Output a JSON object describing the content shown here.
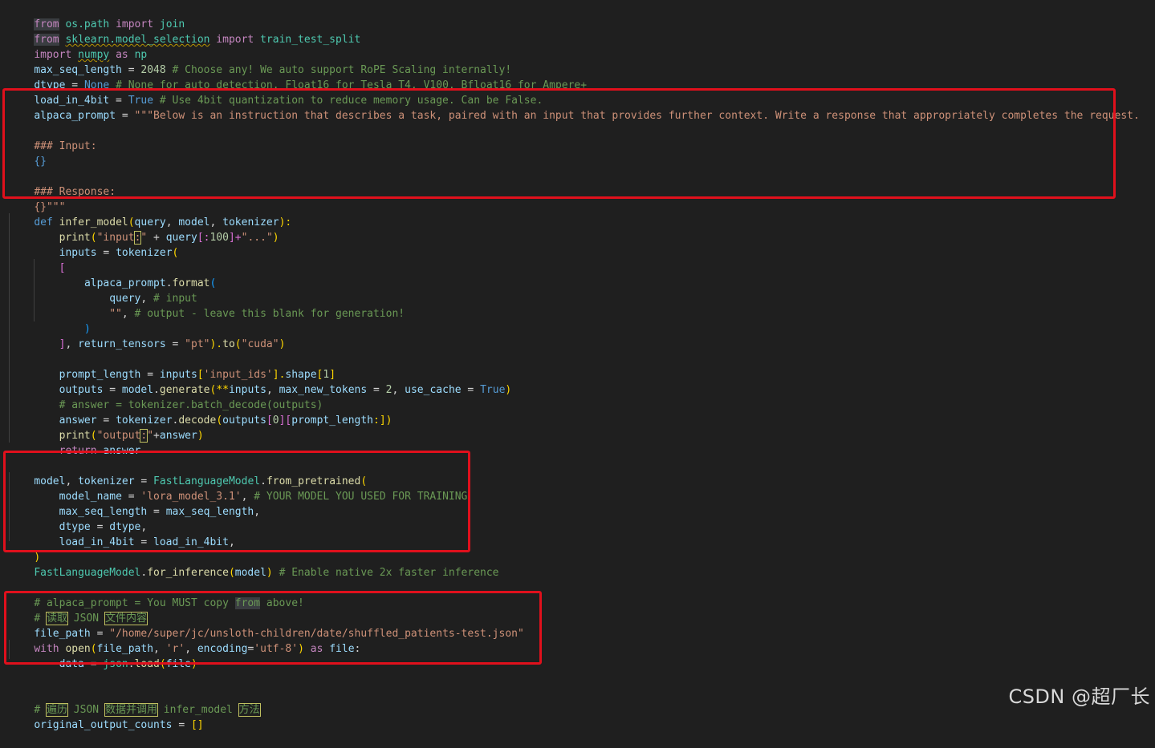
{
  "code": {
    "l1": [
      "from",
      " os.path ",
      "import",
      " join"
    ],
    "l2": [
      "from",
      " ",
      "sklearn.model_selection",
      " ",
      "import",
      " train_test_split"
    ],
    "l3": [
      "import",
      " ",
      "numpy",
      " ",
      "as",
      " ",
      "np"
    ],
    "l4": [
      "max_seq_length",
      " = ",
      "2048",
      " ",
      "# Choose any! We auto support RoPE Scaling internally!"
    ],
    "l5": [
      "dtype",
      " = ",
      "None",
      " ",
      "# None for auto detection. Float16 for Tesla T4, V100, Bfloat16 for Ampere+"
    ],
    "l6": [
      "load_in_4bit",
      " = ",
      "True",
      " ",
      "# Use 4bit quantization to reduce memory usage. Can be False."
    ],
    "l7": [
      "alpaca_prompt",
      " = ",
      "\"\"\"Below is an instruction that describes a task, paired with an input that provides further context. Write a response that appropriately completes the request."
    ],
    "l9": [
      "### Input:"
    ],
    "l10": [
      "{}"
    ],
    "l12": [
      "### Response:"
    ],
    "l13": [
      "{}\"\"\""
    ],
    "l14": [
      "def",
      " ",
      "infer_model",
      "(",
      "query",
      ", ",
      "model",
      ", ",
      "tokenizer",
      "):"
    ],
    "l15": [
      "    ",
      "print",
      "(",
      "\"input",
      ":",
      "\"",
      " + ",
      "query",
      "[:",
      "100",
      "]+",
      "\"...\"",
      ")"
    ],
    "l16": [
      "    ",
      "inputs",
      " = ",
      "tokenizer",
      "("
    ],
    "l17": [
      "    ",
      "["
    ],
    "l18": [
      "        ",
      "alpaca_prompt",
      ".",
      "format",
      "("
    ],
    "l19": [
      "            ",
      "query",
      ", ",
      "# input"
    ],
    "l20": [
      "            ",
      "\"\"",
      ", ",
      "# output - leave this blank for generation!"
    ],
    "l21": [
      "        ",
      ")"
    ],
    "l22": [
      "    ",
      "]",
      ", ",
      "return_tensors",
      " = ",
      "\"pt\"",
      ").",
      "to",
      "(",
      "\"cuda\"",
      ")"
    ],
    "l24": [
      "    ",
      "prompt_length",
      " = ",
      "inputs",
      "[",
      "'input_ids'",
      "].",
      "shape",
      "[",
      "1",
      "]"
    ],
    "l25": [
      "    ",
      "outputs",
      " = ",
      "model",
      ".",
      "generate",
      "(**",
      "inputs",
      ", ",
      "max_new_tokens",
      " = ",
      "2",
      ", ",
      "use_cache",
      " = ",
      "True",
      ")"
    ],
    "l26": [
      "    ",
      "# answer = tokenizer.batch_decode(outputs)"
    ],
    "l27": [
      "    ",
      "answer",
      " = ",
      "tokenizer",
      ".",
      "decode",
      "(",
      "outputs",
      "[",
      "0",
      "][",
      "prompt_length",
      ":])"
    ],
    "l28": [
      "    ",
      "print",
      "(",
      "\"output",
      ":",
      "\"",
      "+",
      "answer",
      ")"
    ],
    "l29": [
      "    ",
      "return",
      " ",
      "answer"
    ],
    "l31": [
      "model",
      ", ",
      "tokenizer",
      " = ",
      "FastLanguageModel",
      ".",
      "from_pretrained",
      "("
    ],
    "l32": [
      "    ",
      "model_name",
      " = ",
      "'lora_model_3.1'",
      ", ",
      "# YOUR MODEL YOU USED FOR TRAINING"
    ],
    "l33": [
      "    ",
      "max_seq_length",
      " = ",
      "max_seq_length",
      ","
    ],
    "l34": [
      "    ",
      "dtype",
      " = ",
      "dtype",
      ","
    ],
    "l35": [
      "    ",
      "load_in_4bit",
      " = ",
      "load_in_4bit",
      ","
    ],
    "l36": [
      ")"
    ],
    "l37": [
      "FastLanguageModel",
      ".",
      "for_inference",
      "(",
      "model",
      ") ",
      "# Enable native 2x faster inference"
    ],
    "l39": [
      "# alpaca_prompt = You MUST copy ",
      "from",
      " above!"
    ],
    "l40": [
      "# ",
      "读取",
      " JSON ",
      "文件内容"
    ],
    "l41": [
      "file_path",
      " = ",
      "\"/home/super/jc/unsloth-children/date/shuffled_patients-test.json\""
    ],
    "l42": [
      "with",
      " ",
      "open",
      "(",
      "file_path",
      ", ",
      "'r'",
      ", ",
      "encoding",
      "=",
      "'utf-8'",
      ") ",
      "as",
      " ",
      "file",
      ":"
    ],
    "l43": [
      "    ",
      "data",
      " = ",
      "json",
      ".",
      "load",
      "(",
      "file",
      ")"
    ],
    "l45": [
      "# ",
      "遍历",
      " JSON ",
      "数据并调用",
      " infer_model ",
      "方法"
    ],
    "l46": [
      "original_output_counts",
      " = ",
      "[]"
    ]
  },
  "watermark": "CSDN @超厂长",
  "colors": {
    "background": "#1f1f1f",
    "keyword": "#c586c0",
    "constant": "#569cd6",
    "function": "#dcdcaa",
    "variable": "#9cdcfe",
    "string": "#ce9178",
    "comment": "#6a9955",
    "number": "#b5cea8",
    "highlight_box": "#e0101c"
  }
}
